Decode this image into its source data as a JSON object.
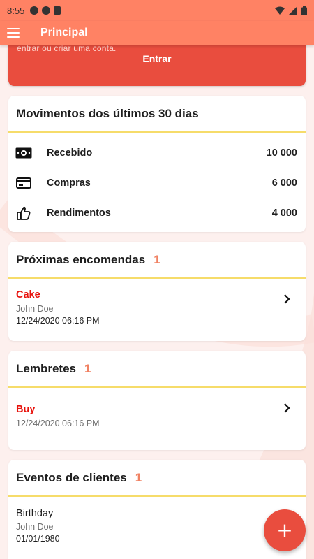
{
  "status_bar": {
    "time": "8:55"
  },
  "app_bar": {
    "title": "Principal"
  },
  "login_card": {
    "message": "entrar ou criar uma conta.",
    "button_label": "Entrar"
  },
  "movements": {
    "title": "Movimentos dos últimos 30 dias",
    "rows": [
      {
        "icon": "cash-icon",
        "label": "Recebido",
        "value": "10 000"
      },
      {
        "icon": "credit-card-icon",
        "label": "Compras",
        "value": "6 000"
      },
      {
        "icon": "thumbs-up-icon",
        "label": "Rendimentos",
        "value": "4 000"
      }
    ]
  },
  "orders": {
    "title": "Próximas encomendas",
    "count": "1",
    "items": [
      {
        "title": "Cake",
        "subtitle": "John Doe",
        "date": "12/24/2020 06:16 PM"
      }
    ]
  },
  "reminders": {
    "title": "Lembretes",
    "count": "1",
    "items": [
      {
        "title": "Buy",
        "date": "12/24/2020 06:16 PM"
      }
    ]
  },
  "client_events": {
    "title": "Eventos de clientes",
    "count": "1",
    "items": [
      {
        "title": "Birthday",
        "subtitle": "John Doe",
        "date": "01/01/1980"
      }
    ]
  },
  "fab": {
    "label": "+"
  },
  "colors": {
    "app_bar": "#ff8264",
    "accent_red": "#e94d3e",
    "divider_yellow": "#f6dc6a",
    "count_orange": "#f08162",
    "item_red": "#e8120c",
    "background": "#fdf0ee"
  }
}
